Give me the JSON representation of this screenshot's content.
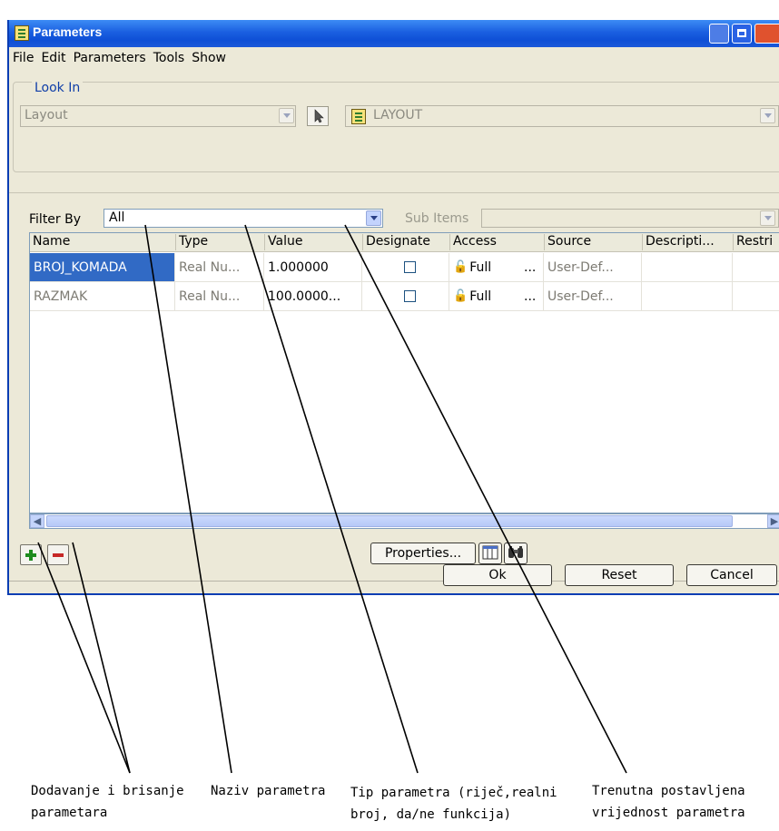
{
  "window": {
    "title": "Parameters"
  },
  "menu": [
    "File",
    "Edit",
    "Parameters",
    "Tools",
    "Show"
  ],
  "look_in": {
    "label": "Look In",
    "scope_value": "Layout",
    "object_value": "LAYOUT"
  },
  "filter": {
    "label": "Filter By",
    "value": "All",
    "sub_items_label": "Sub Items"
  },
  "table": {
    "columns": [
      "Name",
      "Type",
      "Value",
      "Designate",
      "Access",
      "Source",
      "Descripti...",
      "Restri"
    ],
    "rows": [
      {
        "name": "BROJ_KOMADA",
        "type": "Real Nu...",
        "value": "1.000000",
        "access": "Full",
        "more": "...",
        "source": "User-Def..."
      },
      {
        "name": "RAZMAK",
        "type": "Real Nu...",
        "value": "100.0000...",
        "access": "Full",
        "more": "...",
        "source": "User-Def..."
      }
    ]
  },
  "buttons": {
    "properties": "Properties...",
    "ok": "Ok",
    "reset": "Reset",
    "cancel": "Cancel"
  },
  "annotations": {
    "add_remove": [
      "Dodavanje i brisanje",
      "parametara"
    ],
    "name": [
      "Naziv parametra"
    ],
    "type": [
      "Tip parametra (riječ,realni",
      "broj, da/ne funkcija)"
    ],
    "value": [
      "Trenutna postavljena",
      "vrijednost parametra"
    ]
  },
  "colors": {
    "titlebar": "#0e4fd6",
    "selection": "#316ac5",
    "dialog_bg": "#ece9d8",
    "add_icon": "#1e8b1e",
    "remove_icon": "#c62828"
  }
}
